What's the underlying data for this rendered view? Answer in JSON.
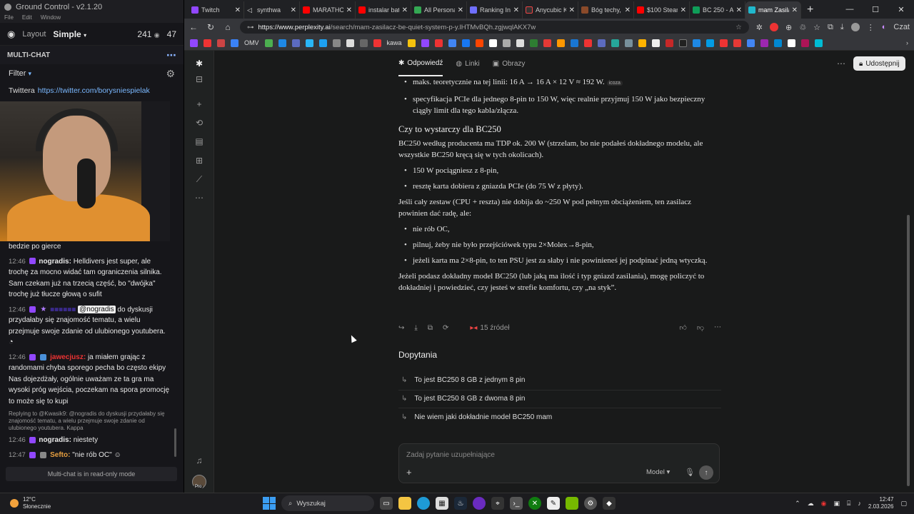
{
  "ground_control": {
    "title": "Ground Control - v2.1.20",
    "menu": [
      "File",
      "Edit",
      "Window"
    ],
    "layout_label": "Layout",
    "layout_value": "Simple",
    "viewers": "241",
    "viewers2": "47",
    "section_title": "MULTI-CHAT",
    "filter_label": "Filter",
    "twitter_label": "Twittera",
    "twitter_link": "https://twitter.com/borysniespielak",
    "chat": [
      {
        "text_only": "bedzie po gierce"
      },
      {
        "time": "12:46",
        "user": "nogradis:",
        "text": "Helldivers jest super, ale trochę za mocno widać tam ograniczenia silnika. Sam czekam już na trzecią część, bo \"dwójka\" trochę już tłucze głową o sufit"
      },
      {
        "time": "12:46",
        "mention": "@nogradis",
        "text": "do dyskusji przydałaby się znajomość tematu, a wielu przejmuje swoje zdanie od ulubionego youtubera."
      },
      {
        "time": "12:46",
        "user": "jawecjusz:",
        "text": "ja miałem grając z randomami chyba sporego pecha bo często ekipy Nas dojezdżały, ogólnie uważam ze ta gra ma wysoki próg wejścia, poczekam na spora promocję to może się to kupi"
      },
      {
        "reply": "Replying to @Kwasik9: @nogradis do dyskusji przydałaby się znajomość tematu, a wielu przejmuje swoje zdanie od ulubionego youtubera. Kappa"
      },
      {
        "time": "12:46",
        "user": "nogradis:",
        "text": "niestety"
      },
      {
        "time": "12:47",
        "user": "Sefto:",
        "text": "\"nie rób OC\""
      }
    ],
    "readonly": "Multi-chat is in read-only mode"
  },
  "browser": {
    "tabs": [
      {
        "label": "Twitch",
        "color": "#9147ff"
      },
      {
        "label": "synthwa",
        "color": "#888888"
      },
      {
        "label": "MARATHON",
        "color": "#ff0000"
      },
      {
        "label": "instalar bate",
        "color": "#ff0000"
      },
      {
        "label": "All Personal F",
        "color": "#34a853"
      },
      {
        "label": "Ranking Influ",
        "color": "#6f6fff"
      },
      {
        "label": "Anycubic Kob",
        "color": "#333333"
      },
      {
        "label": "Bóg techy, b",
        "color": "#8a4a2a"
      },
      {
        "label": "$100 Steam I",
        "color": "#ff0000"
      },
      {
        "label": "BC 250 - Arki",
        "color": "#0f9d58"
      },
      {
        "label": "mam Zasilac",
        "color": "#20b8cd"
      }
    ],
    "url_host": "https://www.perplexity.ai",
    "url_path": "/search/mam-zasilacz-be-quiet-system-p-y.lHTMvBQh.zgjwqlAKX7w",
    "bookmark_labels": [
      "OMV",
      "kawa"
    ],
    "profile_label": "Czat"
  },
  "perplexity": {
    "tabs": [
      "Odpowiedź",
      "Linki",
      "Obrazy"
    ],
    "share": "Udostępnij",
    "content": {
      "bullet1": "maks. teoretycznie na tej linii: 16 A → 16 A × 12 V ≈ 192 W.",
      "bullet1_chip": "icoza",
      "bullet2": "specyfikacja PCIe dla jednego 8-pin to 150 W, więc realnie przyjmuj 150 W jako bezpieczny ciągły limit dla tego kabla/złącza.",
      "heading": "Czy to wystarczy dla BC250",
      "para1": "BC250 według producenta ma TDP ok. 200 W (strzelam, bo nie podałeś dokładnego modelu, ale wszystkie BC250 kręcą się w tych okolicach).",
      "bullet3": "150 W pociągniesz z 8-pin,",
      "bullet4": "resztę karta dobiera z gniazda PCIe (do 75 W z płyty).",
      "para2": "Jeśli cały zestaw (CPU + reszta) nie dobija do ~250 W pod pełnym obciążeniem, ten zasilacz powinien dać radę, ale:",
      "bullet5": "nie rób OC,",
      "bullet6": "pilnuj, żeby nie było przejściówek typu 2×Molex→8-pin,",
      "bullet7": "jeżeli karta ma 2×8-pin, to ten PSU jest za słaby i nie powinieneś jej podpinać jedną wtyczką.",
      "para3": "Jeżeli podasz dokładny model BC250 (lub jaką ma ilość i typ gniazd zasilania), mogę policzyć to dokładniej i powiedzieć, czy jesteś w strefie komfortu, czy „na styk”."
    },
    "sources": "15 źródeł",
    "followups_title": "Dopytania",
    "followups": [
      "To jest BC250 8 GB z jednym 8 pin",
      "To jest BC250 8 GB z dwoma 8 pin",
      "Nie wiem jaki dokładnie model BC250 mam"
    ],
    "ask_placeholder": "Zadaj pytanie uzupełniające",
    "model_label": "Model",
    "pro_label": "Pro"
  },
  "taskbar": {
    "temp": "12°C",
    "weather": "Słonecznie",
    "search": "Wyszukaj",
    "time": "12:47",
    "date": "2.03.2026"
  },
  "colors": {
    "accent": "#20b8cd",
    "twitch": "#9147ff",
    "link": "#7ab8ff"
  }
}
